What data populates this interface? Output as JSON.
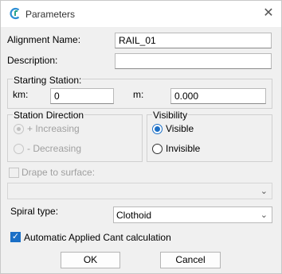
{
  "window": {
    "title": "Parameters",
    "close_glyph": "✕",
    "icon": "app-logo-icon",
    "accent": "#1b6fc6"
  },
  "alignment": {
    "name_label": "Alignment Name:",
    "name_value": "RAIL_01",
    "description_label": "Description:",
    "description_value": ""
  },
  "starting_station": {
    "group_label": "Starting Station:",
    "km_label": "km:",
    "km_value": "0",
    "m_label": "m:",
    "m_value": "0.000"
  },
  "station_direction": {
    "group_label": "Station Direction",
    "increasing_label": "+ Increasing",
    "decreasing_label": "- Decreasing"
  },
  "visibility": {
    "group_label": "Visibility",
    "visible_label": "Visible",
    "invisible_label": "Invisible"
  },
  "drape": {
    "label": "Drape to surface:",
    "value": ""
  },
  "spiral": {
    "label": "Spiral type:",
    "value": "Clothoid"
  },
  "cant": {
    "label": "Automatic Applied Cant calculation",
    "checked": true
  },
  "buttons": {
    "ok": "OK",
    "cancel": "Cancel"
  }
}
